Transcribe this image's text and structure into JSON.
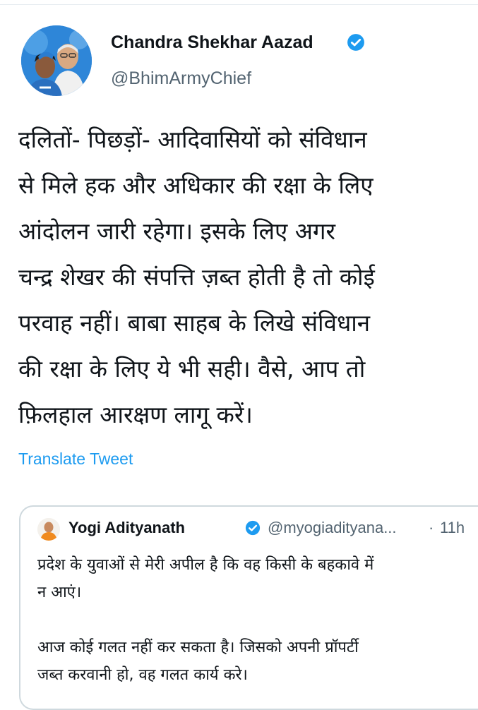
{
  "tweet": {
    "author": {
      "display_name": "Chandra Shekhar Aazad",
      "handle": "@BhimArmyChief",
      "verified_icon": "verified-badge-icon"
    },
    "text_lines": [
      "दलितों- पिछड़ों- आदिवासियों को संविधान",
      "से मिले हक और अधिकार की रक्षा के लिए",
      "आंदोलन जारी रहेगा। इसके लिए अगर",
      "चन्द्र शेखर की संपत्ति ज़ब्त होती है तो कोई",
      "परवाह नहीं। बाबा साहब के लिखे संविधान",
      "की रक्षा के लिए ये भी सही। वैसे, आप तो",
      "फ़िलहाल आरक्षण लागू करें।"
    ],
    "translate_label": "Translate Tweet"
  },
  "quoted_tweet": {
    "display_name": "Yogi Adityanath",
    "handle": "@myogiadityana...",
    "separator": "·",
    "time": "11h",
    "paragraph1": [
      "प्रदेश के युवाओं से मेरी अपील है कि वह किसी के बहकावे में",
      "न आएं।"
    ],
    "paragraph2": [
      "आज कोई गलत नहीं कर सकता है। जिसको अपनी प्रॉपर्टी",
      "जब्त करवानी हो, वह गलत कार्य करे।"
    ]
  },
  "colors": {
    "text": "#0f1419",
    "secondary": "#536471",
    "link": "#1d9bf0",
    "border": "#cfd9de",
    "verified": "#1d9bf0"
  }
}
